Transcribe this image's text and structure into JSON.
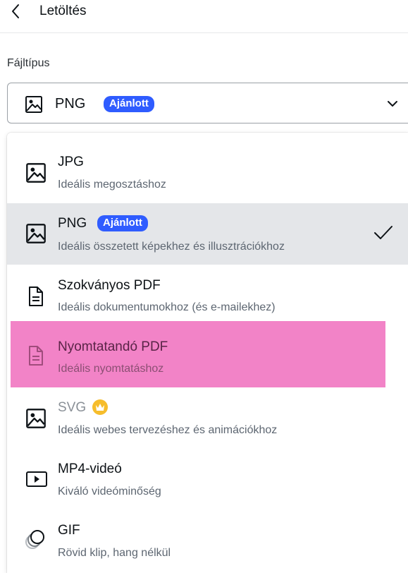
{
  "header": {
    "title": "Letöltés"
  },
  "file_type": {
    "label": "Fájltípus",
    "selected_value": "PNG",
    "selected_badge": "Ajánlott"
  },
  "options": [
    {
      "name": "JPG",
      "desc": "Ideális megosztáshoz",
      "icon": "image-icon"
    },
    {
      "name": "PNG",
      "badge": "Ajánlott",
      "desc": "Ideális összetett képekhez és illusztrációkhoz",
      "icon": "image-icon",
      "selected": true
    },
    {
      "name": "Szokványos PDF",
      "desc": "Ideális dokumentumokhoz (és e-mailekhez)",
      "icon": "document-icon"
    },
    {
      "name": "Nyomtatandó PDF",
      "desc": "Ideális nyomtatáshoz",
      "icon": "document-icon",
      "highlighted": true
    },
    {
      "name": "SVG",
      "desc": "Ideális webes tervezéshez és animációkhoz",
      "icon": "image-icon",
      "pro": "crown-icon"
    },
    {
      "name": "MP4-videó",
      "desc": "Kiváló videóminőség",
      "icon": "video-play-icon"
    },
    {
      "name": "GIF",
      "desc": "Rövid klip, hang nélkül",
      "icon": "gif-circles-icon"
    }
  ],
  "colors": {
    "badge": "#2f5cff",
    "highlight": "#f283c7",
    "selected_row": "#e4e6e9",
    "crown": "#f6bd2c"
  }
}
